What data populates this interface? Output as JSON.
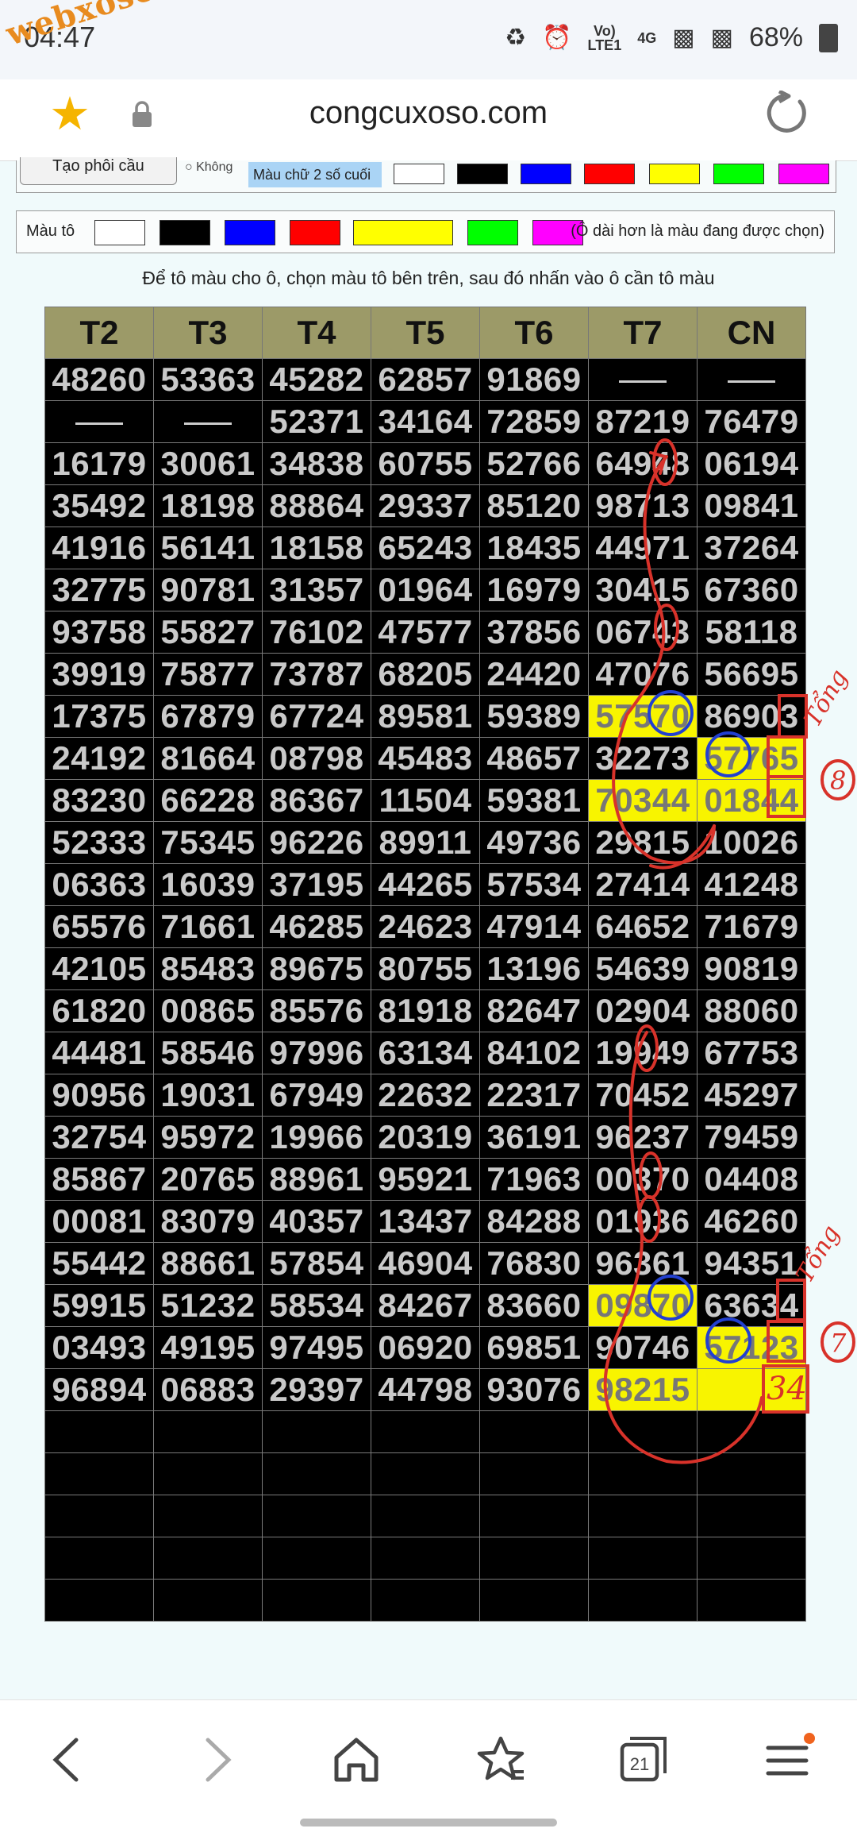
{
  "status": {
    "time": "04:47",
    "watermark": "webxoso.net",
    "network_top": "4G",
    "network_left": "Vo)",
    "network_lte": "LTE1",
    "battery": "68%"
  },
  "browser": {
    "url": "congcuxoso.com"
  },
  "controls": {
    "tao_button": "Tạo phôi cầu",
    "khong_label": "Không",
    "mau_chu_label": "Màu chữ 2 số cuối",
    "mau_to_label": "Màu tô",
    "note": "(Ô dài hơn là màu đang được chọn)",
    "swatch_colors": [
      "#ffffff",
      "#000000",
      "#0000ff",
      "#ff0000",
      "#ffff00",
      "#00ff00",
      "#ff00ff"
    ]
  },
  "instruction": "Để tô màu cho ô, chọn màu tô bên trên, sau đó nhấn vào ô cần tô màu",
  "grid": {
    "headers": [
      "T2",
      "T3",
      "T4",
      "T5",
      "T6",
      "T7",
      "CN"
    ],
    "rows": [
      [
        "48260",
        "53363",
        "45282",
        "62857",
        "91869",
        "",
        ""
      ],
      [
        "",
        "",
        "52371",
        "34164",
        "72859",
        "87219",
        "76479"
      ],
      [
        "16179",
        "30061",
        "34838",
        "60755",
        "52766",
        "64948",
        "06194"
      ],
      [
        "35492",
        "18198",
        "88864",
        "29337",
        "85120",
        "98713",
        "09841"
      ],
      [
        "41916",
        "56141",
        "18158",
        "65243",
        "18435",
        "44971",
        "37264"
      ],
      [
        "32775",
        "90781",
        "31357",
        "01964",
        "16979",
        "30415",
        "67360"
      ],
      [
        "93758",
        "55827",
        "76102",
        "47577",
        "37856",
        "06743",
        "58118"
      ],
      [
        "39919",
        "75877",
        "73787",
        "68205",
        "24420",
        "47076",
        "56695"
      ],
      [
        "17375",
        "67879",
        "67724",
        "89581",
        "59389",
        "57570",
        "86903"
      ],
      [
        "24192",
        "81664",
        "08798",
        "45483",
        "48657",
        "32273",
        "57765"
      ],
      [
        "83230",
        "66228",
        "86367",
        "11504",
        "59381",
        "70344",
        "01844"
      ],
      [
        "52333",
        "75345",
        "96226",
        "89911",
        "49736",
        "29815",
        "10026"
      ],
      [
        "06363",
        "16039",
        "37195",
        "44265",
        "57534",
        "27414",
        "41248"
      ],
      [
        "65576",
        "71661",
        "46285",
        "24623",
        "47914",
        "64652",
        "71679"
      ],
      [
        "42105",
        "85483",
        "89675",
        "80755",
        "13196",
        "54639",
        "90819"
      ],
      [
        "61820",
        "00865",
        "85576",
        "81918",
        "82647",
        "02904",
        "88060"
      ],
      [
        "44481",
        "58546",
        "97996",
        "63134",
        "84102",
        "19949",
        "67753"
      ],
      [
        "90956",
        "19031",
        "67949",
        "22632",
        "22317",
        "70452",
        "45297"
      ],
      [
        "32754",
        "95972",
        "19966",
        "20319",
        "36191",
        "96237",
        "79459"
      ],
      [
        "85867",
        "20765",
        "88961",
        "95921",
        "71963",
        "00370",
        "04408"
      ],
      [
        "00081",
        "83079",
        "40357",
        "13437",
        "84288",
        "01936",
        "46260"
      ],
      [
        "55442",
        "88661",
        "57854",
        "46904",
        "76830",
        "96361",
        "94351"
      ],
      [
        "59915",
        "51232",
        "58534",
        "84267",
        "83660",
        "09870",
        "63634"
      ],
      [
        "03493",
        "49195",
        "97495",
        "06920",
        "69851",
        "90746",
        "57123"
      ],
      [
        "96894",
        "06883",
        "29397",
        "44798",
        "93076",
        "98215",
        ""
      ]
    ],
    "dash_cells": [
      [
        0,
        5
      ],
      [
        0,
        6
      ],
      [
        1,
        0
      ],
      [
        1,
        1
      ]
    ],
    "yellow_cells": [
      [
        8,
        5
      ],
      [
        9,
        6
      ],
      [
        10,
        5
      ],
      [
        10,
        6
      ],
      [
        22,
        5
      ],
      [
        23,
        6
      ],
      [
        24,
        5
      ],
      [
        24,
        6
      ]
    ],
    "empty_rows": 5
  },
  "annotations": {
    "top_label": "Tổng",
    "top_number": "8",
    "bottom_label": "Tổng",
    "bottom_number": "7",
    "bottom_sum": "34"
  }
}
